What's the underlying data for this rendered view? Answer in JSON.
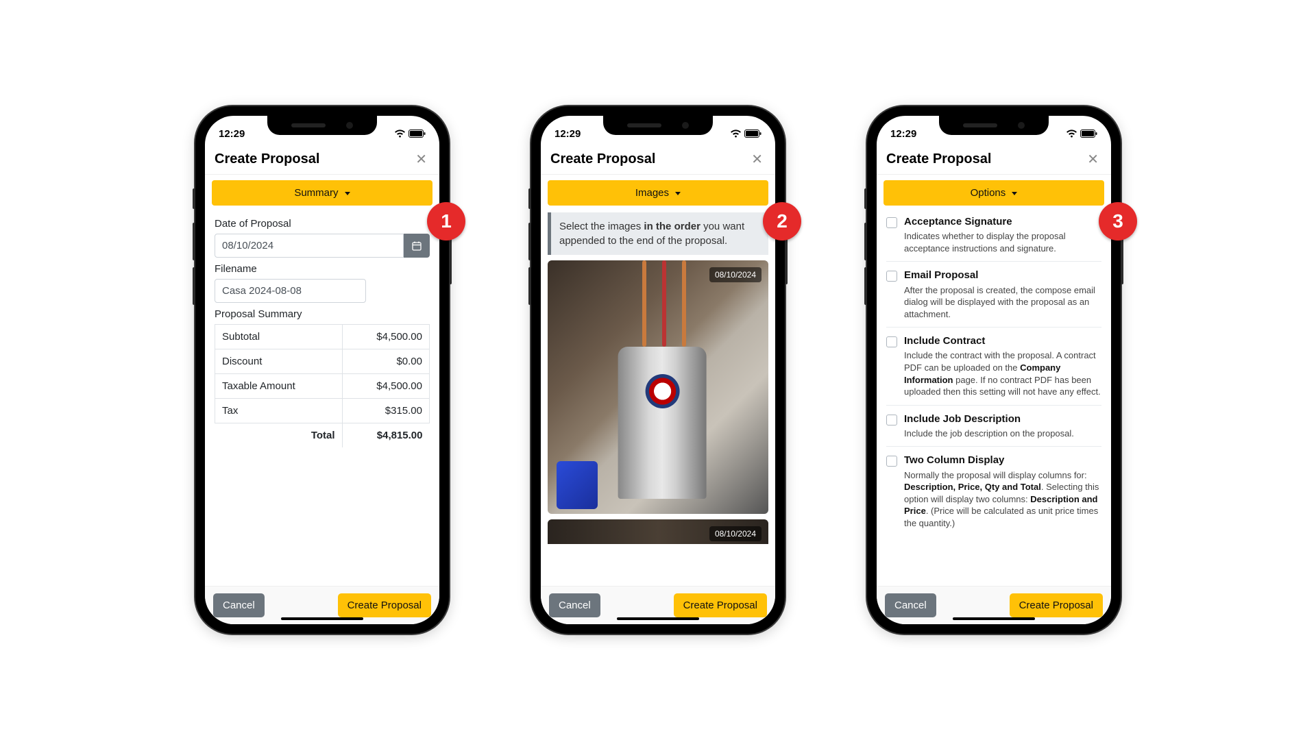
{
  "status": {
    "time": "12:29"
  },
  "colors": {
    "accent": "#ffc107",
    "badge": "#e52a2a",
    "muted": "#6c757d"
  },
  "common": {
    "header_title": "Create Proposal",
    "cancel_label": "Cancel",
    "create_label": "Create Proposal"
  },
  "phone1": {
    "badge": "1",
    "tab_label": "Summary",
    "date_label": "Date of Proposal",
    "date_value": "08/10/2024",
    "filename_label": "Filename",
    "filename_value": "Casa 2024-08-08",
    "summary_label": "Proposal Summary",
    "rows": [
      {
        "label": "Subtotal",
        "value": "$4,500.00"
      },
      {
        "label": "Discount",
        "value": "$0.00"
      },
      {
        "label": "Taxable Amount",
        "value": "$4,500.00"
      },
      {
        "label": "Tax",
        "value": "$315.00"
      }
    ],
    "total_label": "Total",
    "total_value": "$4,815.00"
  },
  "phone2": {
    "badge": "2",
    "tab_label": "Images",
    "info_pre": "Select the images ",
    "info_bold": "in the order",
    "info_post": " you want appended to the end of the proposal.",
    "image1_date": "08/10/2024",
    "image2_date": "08/10/2024"
  },
  "phone3": {
    "badge": "3",
    "tab_label": "Options",
    "options": [
      {
        "title": "Acceptance Signature",
        "desc": "Indicates whether to display the proposal acceptance instructions and signature."
      },
      {
        "title": "Email Proposal",
        "desc": "After the proposal is created, the compose email dialog will be displayed with the proposal as an attachment."
      },
      {
        "title": "Include Contract",
        "desc_pre": "Include the contract with the proposal. A contract PDF can be uploaded on the ",
        "bold1": "Company Information",
        "desc_post": " page. If no contract PDF has been uploaded then this setting will not have any effect."
      },
      {
        "title": "Include Job Description",
        "desc": "Include the job description on the proposal."
      },
      {
        "title": "Two Column Display",
        "desc_pre": "Normally the proposal will display columns for: ",
        "bold1": "Description, Price, Qty and Total",
        "desc_mid": ". Selecting this option will display two columns: ",
        "bold2": "Description and Price",
        "desc_post": ". (Price will be calculated as unit price times the quantity.)"
      }
    ]
  }
}
